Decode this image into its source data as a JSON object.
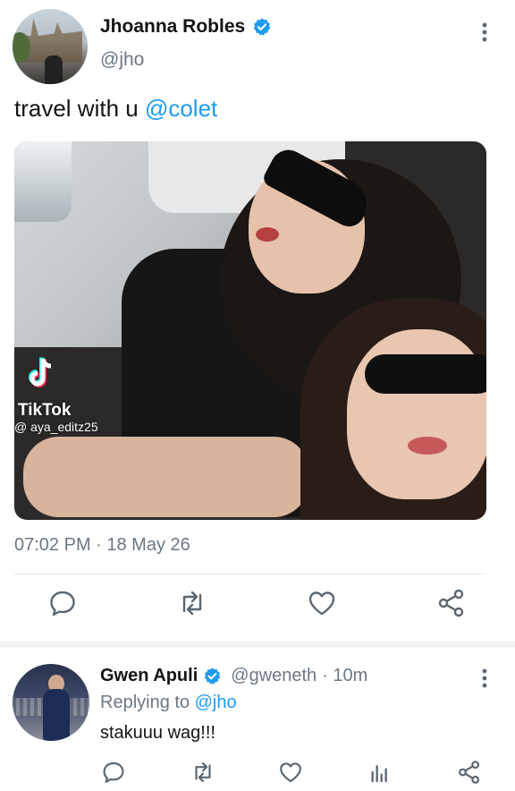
{
  "tweet": {
    "author_name": "Jhoanna Robles",
    "author_handle": "@jho",
    "text_prefix": "travel with u ",
    "text_mention": "@colet",
    "media": {
      "watermark_brand": "TikTok",
      "watermark_user": "@ aya_editz25"
    },
    "timestamp": "07:02 PM · 18 May 26"
  },
  "reply": {
    "author_name": "Gwen Apuli",
    "author_handle": "@gweneth",
    "time": "· 10m",
    "replying_prefix": "Replying to ",
    "replying_mention": "@jho",
    "text": "stakuuu wag!!!"
  },
  "colors": {
    "accent": "#1d9bf0",
    "text": "#141414",
    "muted": "#6b7785",
    "icon": "#5b6670"
  },
  "icons": [
    "verified-badge-icon",
    "more-vertical-icon",
    "reply-icon",
    "retweet-icon",
    "like-icon",
    "share-icon",
    "analytics-icon",
    "tiktok-logo-icon"
  ]
}
